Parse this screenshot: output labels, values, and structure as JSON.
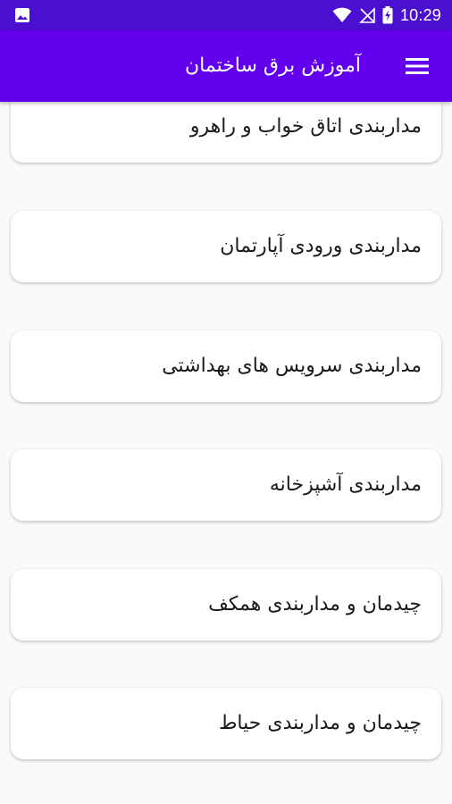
{
  "status_bar": {
    "time": "10:29",
    "background": "#4a0fcf"
  },
  "app_bar": {
    "title": "آموزش برق ساختمان",
    "menu_icon": "hamburger-menu-icon",
    "background": "#6200ee"
  },
  "list": {
    "items": [
      {
        "label": "مداربندی اتاق خواب و راهرو"
      },
      {
        "label": "مداربندی ورودی آپارتمان"
      },
      {
        "label": "مداربندی سرویس های بهداشتی"
      },
      {
        "label": "مداربندی آشپزخانه"
      },
      {
        "label": "چیدمان و مداربندی همکف"
      },
      {
        "label": "چیدمان و مداربندی حیاط"
      }
    ]
  }
}
